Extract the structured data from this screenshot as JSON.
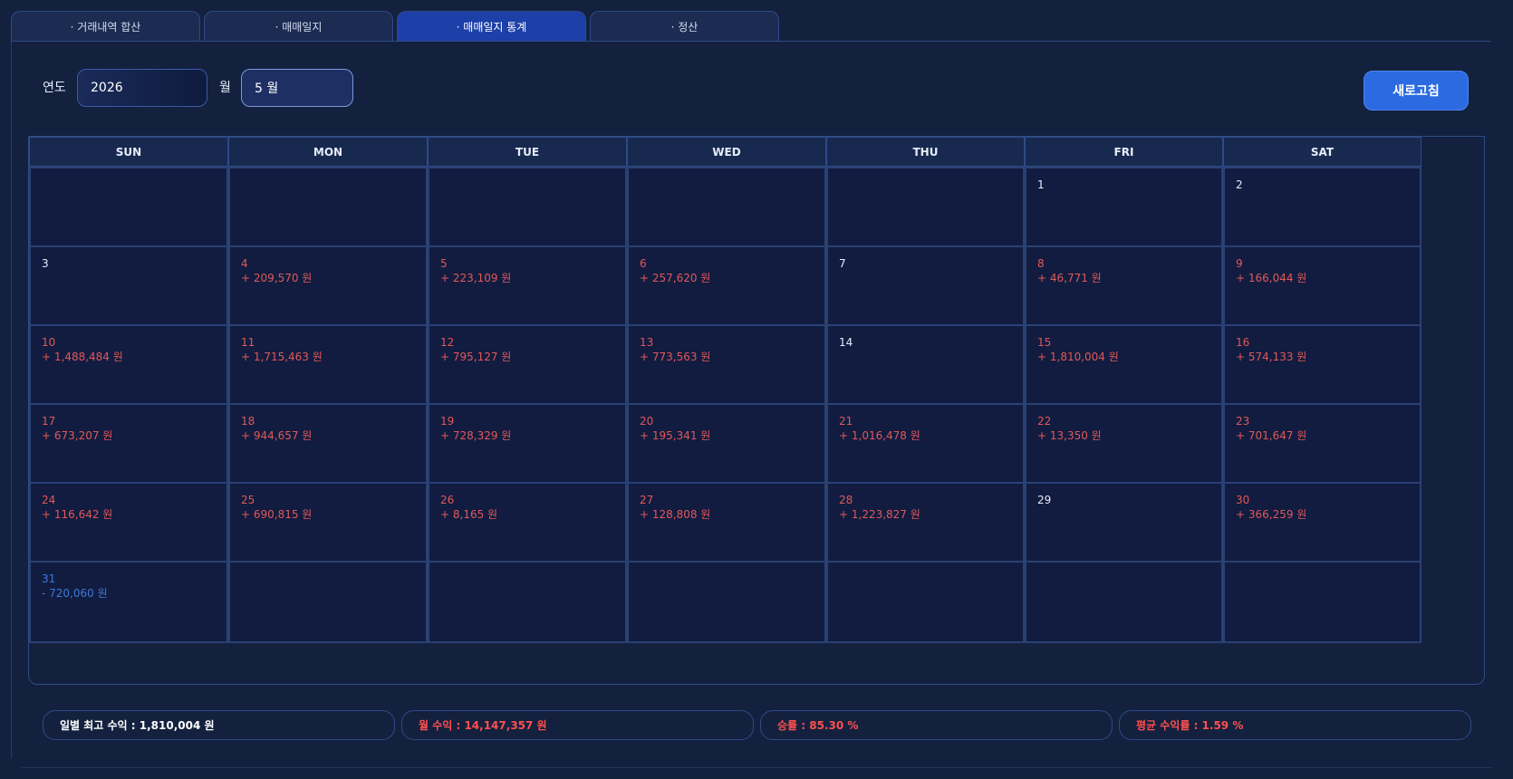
{
  "tabs": [
    {
      "label": "· 거래내역 합산",
      "active": false
    },
    {
      "label": "· 매매일지",
      "active": false
    },
    {
      "label": "· 매매일지 통계",
      "active": true
    },
    {
      "label": "· 정산",
      "active": false
    }
  ],
  "controls": {
    "year_label": "연도",
    "year_value": "2026",
    "month_label": "월",
    "month_value": "5 월",
    "refresh_label": "새로고침"
  },
  "calendar": {
    "weekdays": [
      "SUN",
      "MON",
      "TUE",
      "WED",
      "THU",
      "FRI",
      "SAT"
    ],
    "weeks": [
      [
        null,
        null,
        null,
        null,
        null,
        {
          "day": "1",
          "amount": ""
        },
        {
          "day": "2",
          "amount": ""
        }
      ],
      [
        {
          "day": "3",
          "amount": ""
        },
        {
          "day": "4",
          "amount": "+ 209,570 원"
        },
        {
          "day": "5",
          "amount": "+ 223,109 원"
        },
        {
          "day": "6",
          "amount": "+ 257,620 원"
        },
        {
          "day": "7",
          "amount": ""
        },
        {
          "day": "8",
          "amount": "+ 46,771 원"
        },
        {
          "day": "9",
          "amount": "+ 166,044 원"
        }
      ],
      [
        {
          "day": "10",
          "amount": "+ 1,488,484 원"
        },
        {
          "day": "11",
          "amount": "+ 1,715,463 원"
        },
        {
          "day": "12",
          "amount": "+ 795,127 원"
        },
        {
          "day": "13",
          "amount": "+ 773,563 원"
        },
        {
          "day": "14",
          "amount": ""
        },
        {
          "day": "15",
          "amount": "+ 1,810,004 원"
        },
        {
          "day": "16",
          "amount": "+ 574,133 원"
        }
      ],
      [
        {
          "day": "17",
          "amount": "+ 673,207 원"
        },
        {
          "day": "18",
          "amount": "+ 944,657 원"
        },
        {
          "day": "19",
          "amount": "+ 728,329 원"
        },
        {
          "day": "20",
          "amount": "+ 195,341 원"
        },
        {
          "day": "21",
          "amount": "+ 1,016,478 원"
        },
        {
          "day": "22",
          "amount": "+ 13,350 원"
        },
        {
          "day": "23",
          "amount": "+ 701,647 원"
        }
      ],
      [
        {
          "day": "24",
          "amount": "+ 116,642 원"
        },
        {
          "day": "25",
          "amount": "+ 690,815 원"
        },
        {
          "day": "26",
          "amount": "+ 8,165 원"
        },
        {
          "day": "27",
          "amount": "+ 128,808 원"
        },
        {
          "day": "28",
          "amount": "+ 1,223,827 원"
        },
        {
          "day": "29",
          "amount": ""
        },
        {
          "day": "30",
          "amount": "+ 366,259 원"
        }
      ],
      [
        {
          "day": "31",
          "amount": "- 720,060 원"
        },
        null,
        null,
        null,
        null,
        null,
        null
      ]
    ]
  },
  "summary": [
    {
      "text": "일별 최고 수익 : 1,810,004 원",
      "tone": "white"
    },
    {
      "text": "월 수익 : 14,147,357 원",
      "tone": "red"
    },
    {
      "text": "승률 : 85.30 %",
      "tone": "red"
    },
    {
      "text": "평균 수익률 : 1.59 %",
      "tone": "red"
    }
  ],
  "colors": {
    "positive": "#e25858",
    "negative": "#3f79d6",
    "accent": "#2b6ae0"
  }
}
